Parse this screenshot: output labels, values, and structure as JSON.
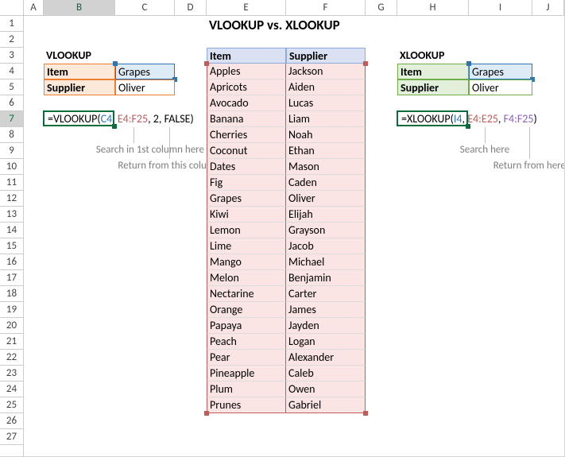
{
  "cols": [
    "A",
    "B",
    "C",
    "D",
    "E",
    "F",
    "G",
    "H",
    "I",
    "J"
  ],
  "title": "VLOOKUP vs. XLOOKUP",
  "vlookup": {
    "heading": "VLOOKUP",
    "item_label": "Item",
    "item_value": "Grapes",
    "supplier_label": "Supplier",
    "supplier_value": "Oliver",
    "formula": {
      "fn": "=VLOOKUP(",
      "a1": "C4",
      "s1": ", ",
      "a2": "E4:F25",
      "s2": ", ",
      "a3": "2",
      "s3": ", ",
      "a4": "FALSE",
      "cl": ")"
    },
    "anno1": "Search in 1st column here",
    "anno2": "Return from this column"
  },
  "xlookup": {
    "heading": "XLOOKUP",
    "item_label": "Item",
    "item_value": "Grapes",
    "supplier_label": "Supplier",
    "supplier_value": "Oliver",
    "formula": {
      "fn": "=XLOOKUP(",
      "a1": "I4",
      "s1": ", ",
      "a2": "E4:E25",
      "s2": ", ",
      "a3": "F4:F25",
      "cl": ")"
    },
    "anno1": "Search here",
    "anno2": "Return from here"
  },
  "table": {
    "head_item": "Item",
    "head_supplier": "Supplier",
    "rows": [
      {
        "item": "Apples",
        "supplier": "Jackson"
      },
      {
        "item": "Apricots",
        "supplier": "Aiden"
      },
      {
        "item": "Avocado",
        "supplier": "Lucas"
      },
      {
        "item": "Banana",
        "supplier": "Liam"
      },
      {
        "item": "Cherries",
        "supplier": "Noah"
      },
      {
        "item": "Coconut",
        "supplier": "Ethan"
      },
      {
        "item": "Dates",
        "supplier": "Mason"
      },
      {
        "item": "Fig",
        "supplier": "Caden"
      },
      {
        "item": "Grapes",
        "supplier": "Oliver"
      },
      {
        "item": "Kiwi",
        "supplier": "Elijah"
      },
      {
        "item": "Lemon",
        "supplier": "Grayson"
      },
      {
        "item": "Lime",
        "supplier": "Jacob"
      },
      {
        "item": "Mango",
        "supplier": "Michael"
      },
      {
        "item": "Melon",
        "supplier": "Benjamin"
      },
      {
        "item": "Nectarine",
        "supplier": "Carter"
      },
      {
        "item": "Orange",
        "supplier": "James"
      },
      {
        "item": "Papaya",
        "supplier": "Jayden"
      },
      {
        "item": "Peach",
        "supplier": "Logan"
      },
      {
        "item": "Pear",
        "supplier": "Alexander"
      },
      {
        "item": "Pineapple",
        "supplier": "Caleb"
      },
      {
        "item": "Plum",
        "supplier": "Owen"
      },
      {
        "item": "Prunes",
        "supplier": "Gabriel"
      }
    ]
  },
  "chart_data": {
    "type": "table",
    "columns": [
      "Item",
      "Supplier"
    ],
    "rows": [
      [
        "Apples",
        "Jackson"
      ],
      [
        "Apricots",
        "Aiden"
      ],
      [
        "Avocado",
        "Lucas"
      ],
      [
        "Banana",
        "Liam"
      ],
      [
        "Cherries",
        "Noah"
      ],
      [
        "Coconut",
        "Ethan"
      ],
      [
        "Dates",
        "Mason"
      ],
      [
        "Fig",
        "Caden"
      ],
      [
        "Grapes",
        "Oliver"
      ],
      [
        "Kiwi",
        "Elijah"
      ],
      [
        "Lemon",
        "Grayson"
      ],
      [
        "Lime",
        "Jacob"
      ],
      [
        "Mango",
        "Michael"
      ],
      [
        "Melon",
        "Benjamin"
      ],
      [
        "Nectarine",
        "Carter"
      ],
      [
        "Orange",
        "James"
      ],
      [
        "Papaya",
        "Jayden"
      ],
      [
        "Peach",
        "Logan"
      ],
      [
        "Pear",
        "Alexander"
      ],
      [
        "Pineapple",
        "Caleb"
      ],
      [
        "Plum",
        "Owen"
      ],
      [
        "Prunes",
        "Gabriel"
      ]
    ]
  }
}
